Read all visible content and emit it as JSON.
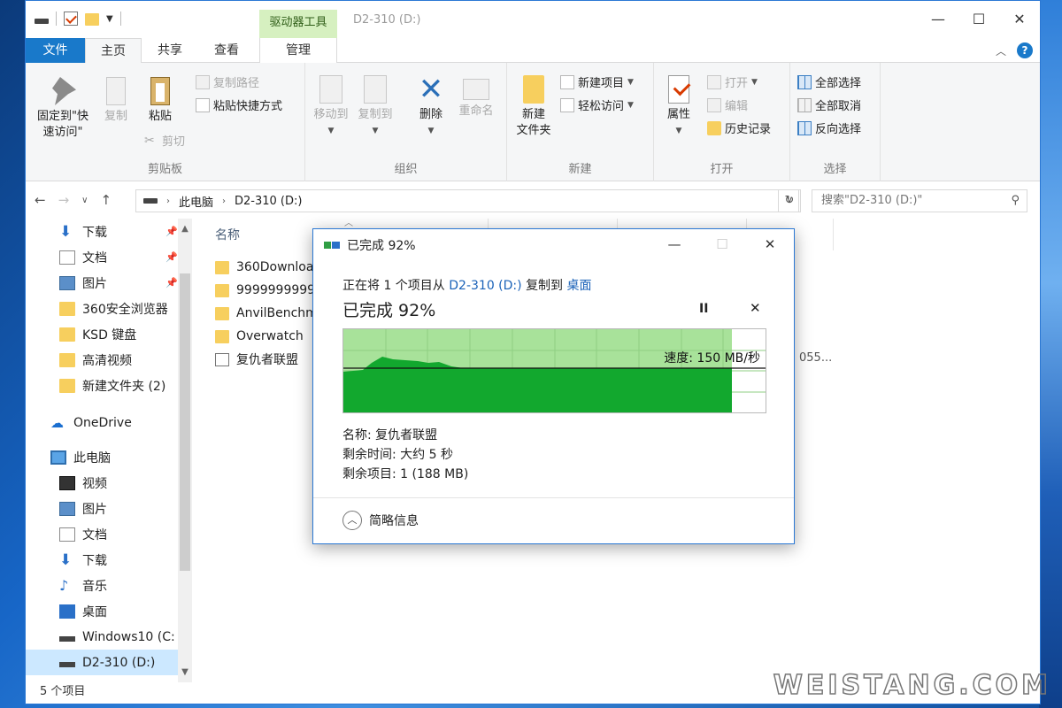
{
  "window": {
    "title": "D2-310 (D:)",
    "context_tab": "驱动器工具",
    "controls": [
      "—",
      "☐",
      "✕"
    ]
  },
  "ribbon_tabs": {
    "file": "文件",
    "home": "主页",
    "share": "共享",
    "view": "查看",
    "manage": "管理"
  },
  "ribbon": {
    "clipboard": {
      "label": "剪贴板",
      "pin": "固定到\"快速访问\"",
      "pin_line1": "固定到\"快",
      "pin_line2": "速访问\"",
      "copy": "复制",
      "paste": "粘贴",
      "copy_path": "复制路径",
      "paste_shortcut": "粘贴快捷方式",
      "cut": "剪切"
    },
    "organize": {
      "label": "组织",
      "move_to": "移动到",
      "copy_to": "复制到",
      "delete": "删除",
      "rename": "重命名"
    },
    "new": {
      "label": "新建",
      "new_folder_line1": "新建",
      "new_folder_line2": "文件夹",
      "new_item": "新建项目",
      "easy_access": "轻松访问"
    },
    "open": {
      "label": "打开",
      "properties": "属性",
      "open": "打开",
      "edit": "编辑",
      "history": "历史记录"
    },
    "select": {
      "label": "选择",
      "select_all": "全部选择",
      "select_none": "全部取消",
      "invert": "反向选择"
    }
  },
  "address": {
    "segments": [
      "此电脑",
      "D2-310 (D:)"
    ],
    "search_placeholder": "搜索\"D2-310 (D:)\""
  },
  "nav_pane": {
    "items": [
      {
        "label": "下载",
        "icon": "download-icon",
        "pinned": true
      },
      {
        "label": "文档",
        "icon": "document-icon",
        "pinned": true
      },
      {
        "label": "图片",
        "icon": "picture-icon",
        "pinned": true
      },
      {
        "label": "360安全浏览器",
        "icon": "folder-icon"
      },
      {
        "label": "KSD 键盘",
        "icon": "folder-icon"
      },
      {
        "label": "高清视频",
        "icon": "folder-icon"
      },
      {
        "label": "新建文件夹 (2)",
        "icon": "folder-icon"
      },
      {
        "label": "OneDrive",
        "icon": "cloud-icon"
      },
      {
        "label": "此电脑",
        "icon": "computer-icon"
      },
      {
        "label": "视频",
        "icon": "video-icon"
      },
      {
        "label": "图片",
        "icon": "picture-icon"
      },
      {
        "label": "文档",
        "icon": "document-icon"
      },
      {
        "label": "下载",
        "icon": "download-icon"
      },
      {
        "label": "音乐",
        "icon": "music-icon"
      },
      {
        "label": "桌面",
        "icon": "desktop-icon"
      },
      {
        "label": "Windows10 (C:",
        "icon": "drive-icon"
      },
      {
        "label": "D2-310 (D:)",
        "icon": "drive-icon",
        "selected": true
      }
    ]
  },
  "file_list": {
    "column_name": "名称",
    "items": [
      {
        "name": "360Downloa",
        "type": "folder"
      },
      {
        "name": "9999999999",
        "type": "folder"
      },
      {
        "name": "AnvilBenchm",
        "type": "folder"
      },
      {
        "name": "Overwatch",
        "type": "folder"
      },
      {
        "name": "复仇者联盟",
        "type": "file"
      }
    ],
    "truncated_text": "055..."
  },
  "status": {
    "item_count": "5 个项目"
  },
  "copy_dialog": {
    "title": "已完成 92%",
    "line_prefix": "正在将 1 个项目从",
    "source": "D2-310 (D:)",
    "line_mid": "复制到",
    "destination": "桌面",
    "progress_text": "已完成 92%",
    "progress_percent": 92,
    "speed": "速度: 150 MB/秒",
    "name": "名称: 复仇者联盟",
    "time_left": "剩余时间: 大约 5 秒",
    "items_left": "剩余项目: 1 (188 MB)",
    "details": "简略信息",
    "pause": "II",
    "stop": "✕"
  },
  "watermark": "WEISTANG.COM"
}
